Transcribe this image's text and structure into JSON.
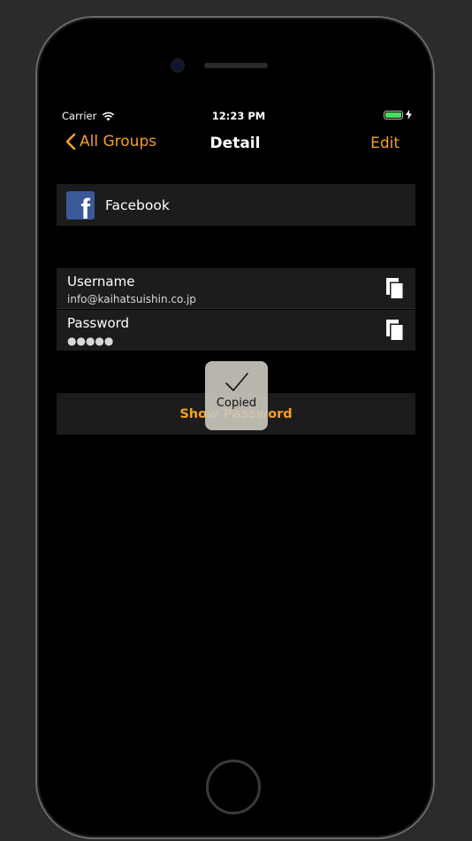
{
  "status_bar": {
    "carrier": "Carrier",
    "time": "12:23 PM",
    "battery_color": "#4cd964"
  },
  "nav": {
    "back_label": "All Groups",
    "title": "Detail",
    "edit_label": "Edit",
    "accent_color": "#f5a020"
  },
  "group": {
    "icon": "facebook-icon",
    "name": "Facebook"
  },
  "fields": {
    "username": {
      "label": "Username",
      "value": "info@kaihatsuishin.co.jp"
    },
    "password": {
      "label": "Password",
      "value": "●●●●●"
    }
  },
  "show_password_label": "Show Password",
  "toast": {
    "label": "Copied",
    "icon": "checkmark-icon"
  }
}
